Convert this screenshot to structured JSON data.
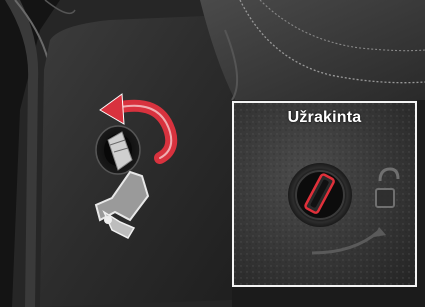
{
  "inset": {
    "label": "Užrakinta"
  },
  "icons": {
    "rotation_arrow": "curved-arrow-icon",
    "padlock": "padlock-icon"
  },
  "colors": {
    "arrow": "#d8323e",
    "keyslot_highlight": "#e0303a",
    "inset_border": "#f4f4f4"
  }
}
